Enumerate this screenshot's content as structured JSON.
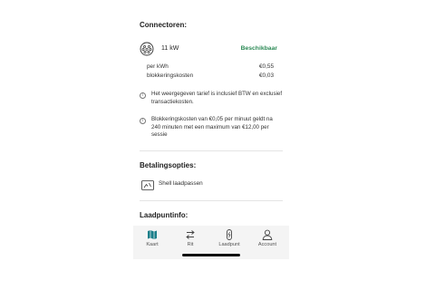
{
  "connectors": {
    "title": "Connectoren:",
    "power": "11 kW",
    "status": "Beschikbaar",
    "status_color": "#2e8b57",
    "price_rows": [
      {
        "label": "per kWh",
        "value": "€0,55"
      },
      {
        "label": "blokkeringskosten",
        "value": "€0,03"
      }
    ],
    "info": [
      "Het weergegeven tarief is inclusief BTW en exclusief transactiekosten.",
      "Blokkeringskosten van €0,05 per minuut geldt na 240 minuten met een maximum van €12,00 per sessie"
    ]
  },
  "payment": {
    "title": "Betalingsopties:",
    "option": "Shell laadpassen"
  },
  "charging_point": {
    "title": "Laadpuntinfo:"
  },
  "tabs": [
    {
      "label": "Kaart",
      "icon": "map-icon",
      "active": true
    },
    {
      "label": "Rit",
      "icon": "route-icon",
      "active": false
    },
    {
      "label": "Laadpunt",
      "icon": "charger-icon",
      "active": false
    },
    {
      "label": "Account",
      "icon": "person-icon",
      "active": false
    }
  ],
  "accent_color": "#1b7f8a"
}
